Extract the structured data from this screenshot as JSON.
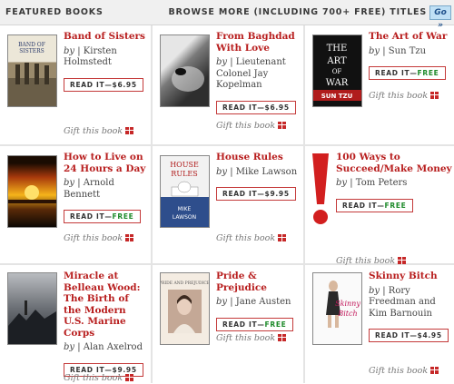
{
  "header": {
    "featured_label": "FEATURED BOOKS",
    "browse_label": "BROWSE MORE (INCLUDING 700+ FREE) TITLES",
    "go_label": "Go »"
  },
  "labels": {
    "by": "by",
    "gift": "Gift this book"
  },
  "books": [
    {
      "title": "Band of Sisters",
      "author": "Kirsten Holmstedt",
      "read_prefix": "READ IT—",
      "price": "$6.95",
      "is_free": false,
      "cover_text": "BAND OF SISTERS",
      "cover_icon": "soldiers-cover-icon"
    },
    {
      "title": "From Baghdad With Love",
      "author": "Lieutenant Colonel Jay Kopelman",
      "read_prefix": "READ IT—",
      "price": "$6.95",
      "is_free": false,
      "cover_text": "",
      "cover_icon": "dog-photo-cover-icon"
    },
    {
      "title": "The Art of War",
      "author": "Sun Tzu",
      "read_prefix": "READ IT—",
      "price": "FREE",
      "is_free": true,
      "cover_text": "THE ART OF WAR",
      "cover_author": "SUN TZU",
      "cover_icon": "black-red-cover-icon"
    },
    {
      "title": "How to Live on 24 Hours a Day",
      "author": "Arnold Bennett",
      "read_prefix": "READ IT—",
      "price": "FREE",
      "is_free": true,
      "cover_text": "",
      "cover_icon": "sunset-cover-icon"
    },
    {
      "title": "House Rules",
      "author": "Mike Lawson",
      "read_prefix": "READ IT—",
      "price": "$9.95",
      "is_free": false,
      "cover_text": "HOUSE RULES",
      "cover_author": "MIKE LAWSON",
      "cover_icon": "capitol-cover-icon"
    },
    {
      "title": "100 Ways to Succeed/Make Money",
      "author": "Tom Peters",
      "read_prefix": "READ IT—",
      "price": "FREE",
      "is_free": true,
      "cover_text": "",
      "cover_icon": "exclamation-cover-icon"
    },
    {
      "title": "Miracle at Belleau Wood: The Birth of the Modern U.S. Marine Corps",
      "author": "Alan Axelrod",
      "read_prefix": "READ IT—",
      "price": "$9.95",
      "is_free": false,
      "cover_text": "",
      "cover_icon": "battle-cover-icon"
    },
    {
      "title": "Pride & Prejudice",
      "author": "Jane Austen",
      "read_prefix": "READ IT—",
      "price": "FREE",
      "is_free": true,
      "cover_text": "PRIDE AND PREJUDICE",
      "cover_icon": "portrait-cover-icon"
    },
    {
      "title": "Skinny Bitch",
      "author": "Rory Freedman and Kim Barnouin",
      "read_prefix": "READ IT—",
      "price": "$4.95",
      "is_free": false,
      "cover_text": "Skinny Bitch",
      "cover_icon": "woman-cover-icon"
    }
  ],
  "colors": {
    "title": "#b81e1e",
    "free": "#1d8a2a",
    "button_border": "#c43a3a",
    "gift_icon": "#c62828"
  }
}
